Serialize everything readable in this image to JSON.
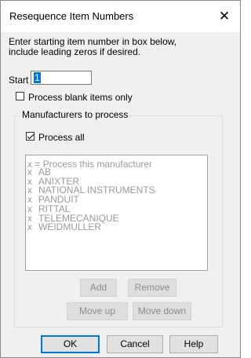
{
  "window": {
    "title": "Resequence Item Numbers",
    "close_glyph": "✕"
  },
  "instructions": [
    "Enter starting item number in box below,",
    "include leading zeros if desired."
  ],
  "start": {
    "label": "Start",
    "value": "1"
  },
  "process_blank": {
    "label": "Process blank items only",
    "checked": false
  },
  "manufacturers": {
    "group_label": "Manufacturers to process",
    "process_all": {
      "label": "Process all",
      "checked": true
    },
    "list_hint": "x = Process this manufacturer",
    "items": [
      {
        "mark": "x",
        "name": "AB"
      },
      {
        "mark": "x",
        "name": "ANIXTER"
      },
      {
        "mark": "x",
        "name": "NATIONAL INSTRUMENTS"
      },
      {
        "mark": "x",
        "name": "PANDUIT"
      },
      {
        "mark": "x",
        "name": "RITTAL"
      },
      {
        "mark": "x",
        "name": "TELEMECANIQUE"
      },
      {
        "mark": "x",
        "name": "WEIDMULLER"
      }
    ],
    "buttons": {
      "add": "Add",
      "remove": "Remove",
      "move_up": "Move up",
      "move_down": "Move down"
    }
  },
  "footer": {
    "ok": "OK",
    "cancel": "Cancel",
    "help": "Help"
  }
}
